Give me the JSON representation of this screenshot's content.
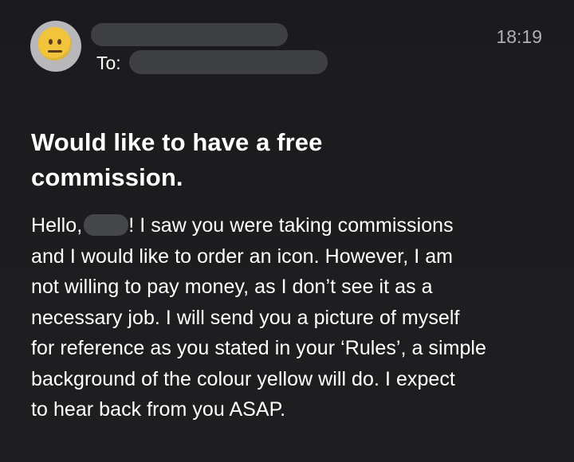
{
  "email": {
    "sender": {
      "avatar_icon": "neutral-face-emoji-icon",
      "name_redacted": true
    },
    "recipient": {
      "label": "To:",
      "name_redacted": true
    },
    "time": "18:19",
    "subject": {
      "line_1": "Would like to have a free",
      "line_2": "commission."
    },
    "body": {
      "greeting_prefix": "Hello,",
      "line_1_suffix": "! I saw you were taking commissions",
      "line_2": "and I would like to order an icon. However, I am",
      "line_3": "not willing to pay money, as I don’t see it as a",
      "line_4": "necessary job. I will send you a picture of myself",
      "line_5": "for reference as you stated in your ‘Rules’, a simple",
      "line_6": "background of the colour yellow will do. I expect",
      "line_7": "to hear back from you ASAP."
    },
    "colors": {
      "background": "#1c1c1e",
      "text": "#ffffff",
      "secondary_text": "#aeb0b6",
      "redaction": "#3f4044",
      "avatar_face": "#f2c43b"
    }
  }
}
